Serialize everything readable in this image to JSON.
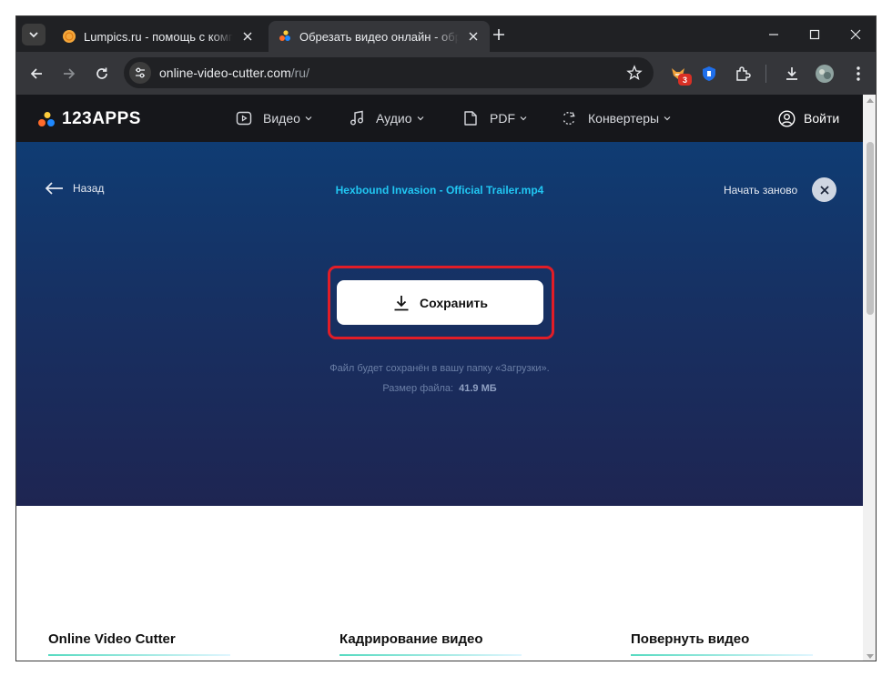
{
  "browser": {
    "tabs": [
      {
        "title": "Lumpics.ru - помощь с компьютером",
        "active": false
      },
      {
        "title": "Обрезать видео онлайн - обрезать видео",
        "active": true
      }
    ],
    "url": {
      "host": "online-video-cutter.com",
      "path": "/ru/"
    },
    "extension_badge": "3"
  },
  "site": {
    "logo": "123APPS",
    "nav": [
      {
        "label": "Видео"
      },
      {
        "label": "Аудио"
      },
      {
        "label": "PDF"
      },
      {
        "label": "Конвертеры"
      }
    ],
    "login": "Войти"
  },
  "editor": {
    "back": "Назад",
    "filename": "Hexbound Invasion - Official Trailer.mp4",
    "restart": "Начать заново",
    "save": "Сохранить",
    "note": "Файл будет сохранён в вашу папку «Загрузки».",
    "size_label": "Размер файла:",
    "size_value": "41.9 МБ"
  },
  "footer": {
    "links": [
      "Online Video Cutter",
      "Кадрирование видео",
      "Повернуть видео"
    ]
  },
  "colors": {
    "accent_cyan": "#21c7f3",
    "highlight_red": "#e11d27",
    "logo_dots": [
      "#ff6b2b",
      "#1e88ff",
      "#ffcd3c"
    ]
  }
}
